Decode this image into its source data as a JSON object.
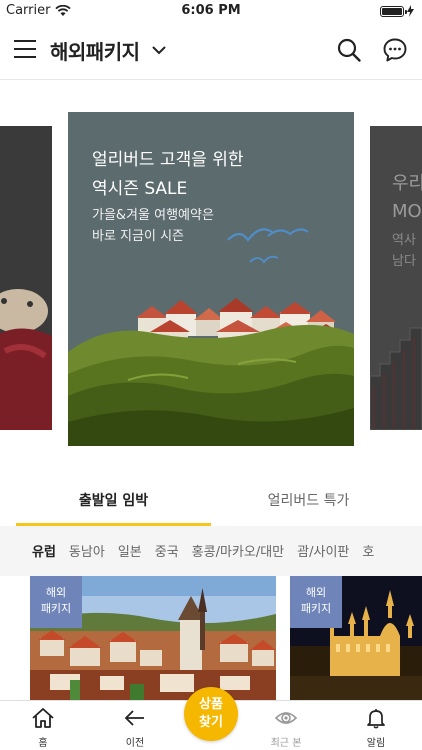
{
  "status_bar": {
    "carrier": "Carrier",
    "time": "6:06 PM"
  },
  "header": {
    "title": "해외패키지"
  },
  "carousel": {
    "main": {
      "headline_line1": "얼리버드 고객을 위한",
      "headline_line2": "역시즌 SALE",
      "sub_line1": "가을&겨울 여행예약은",
      "sub_line2": "바로 지금이 시즌"
    },
    "next_peek": {
      "title_line1": "우리",
      "title_line2": "MO",
      "sub_line1": "역사",
      "sub_line2": "남다"
    }
  },
  "tabs": [
    {
      "label": "출발일 임박",
      "active": true
    },
    {
      "label": "얼리버드 특가",
      "active": false
    }
  ],
  "regions": [
    "유럽",
    "동남아",
    "일본",
    "중국",
    "홍콩/마카오/대만",
    "괌/사이판",
    "호"
  ],
  "active_region": "유럽",
  "cards": [
    {
      "badge_line1": "해외",
      "badge_line2": "패키지"
    },
    {
      "badge_line1": "해외",
      "badge_line2": "패키지"
    }
  ],
  "bottom_nav": {
    "home": "홈",
    "back": "이전",
    "search_line1": "상품",
    "search_line2": "찾기",
    "recent": "최근 본",
    "alerts": "알림"
  },
  "colors": {
    "accent": "#f7c41a",
    "search_button": "#f5b700",
    "badge": "#6f85b9",
    "banner_bg": "#5c6b6e"
  }
}
